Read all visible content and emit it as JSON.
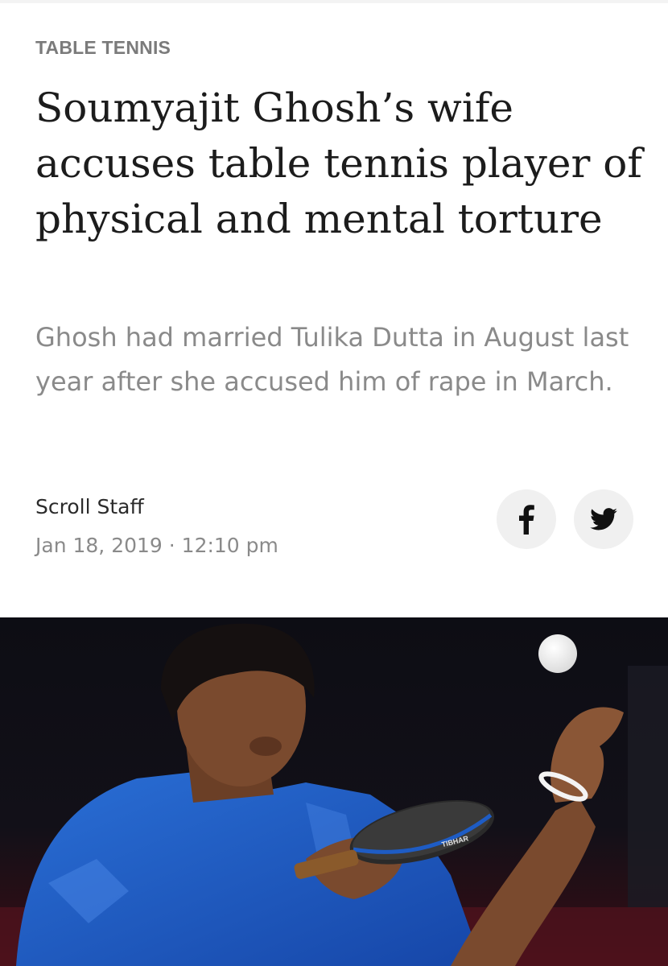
{
  "article": {
    "category": "TABLE TENNIS",
    "headline": "Soumyajit Ghosh’s wife accuses table tennis player of physical and mental torture",
    "summary": "Ghosh had married Tulika Dutta in August last year after she accused him of rape in March.",
    "author": "Scroll Staff",
    "date": "Jan 18, 2019",
    "separator": "·",
    "time": "12:10 pm"
  },
  "share": {
    "facebook_icon": "facebook-icon",
    "twitter_icon": "twitter-icon"
  },
  "hero_image": {
    "paddle_brand": "TIBHAR"
  },
  "colors": {
    "category": "#7b7b7b",
    "headline": "#1c1c1c",
    "summary": "#8a8a8a",
    "share_bg": "#f0f0f0",
    "share_icon": "#111111"
  }
}
